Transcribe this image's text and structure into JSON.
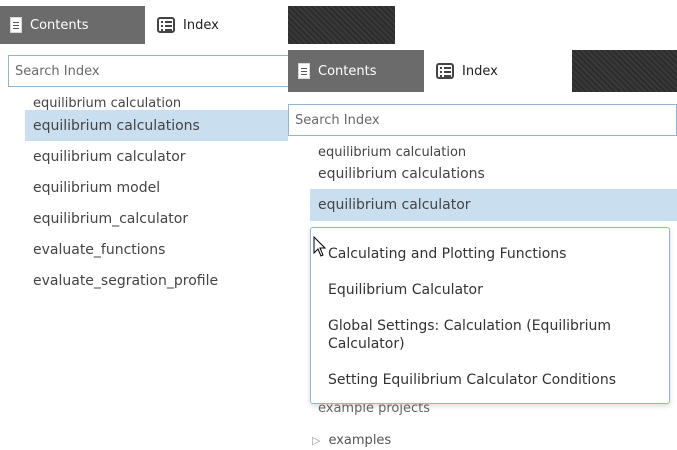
{
  "back": {
    "tabs": [
      {
        "label": "Contents",
        "icon": "document-icon"
      },
      {
        "label": "Index",
        "icon": "list-icon"
      }
    ],
    "search_placeholder": "Search Index",
    "items": [
      "equilibrium calculation",
      "equilibrium calculations",
      "equilibrium calculator",
      "equilibrium model",
      "equilibrium_calculator",
      "evaluate_functions",
      "evaluate_segration_profile"
    ],
    "selected_item": "equilibrium calculations"
  },
  "front": {
    "tabs": [
      {
        "label": "Contents",
        "icon": "document-icon"
      },
      {
        "label": "Index",
        "icon": "list-icon"
      }
    ],
    "search_placeholder": "Search Index",
    "items": [
      "equilibrium calculation",
      "equilibrium calculations",
      "equilibrium calculator"
    ],
    "selected_item": "equilibrium calculator",
    "popup": [
      "Calculating and Plotting Functions",
      "Equilibrium Calculator",
      "Global Settings: Calculation (Equilibrium Calculator)",
      "Setting Equilibrium Calculator Conditions"
    ],
    "below_items": [
      "example projects",
      "examples"
    ]
  },
  "colors": {
    "selection": "#c9deee",
    "search_border": "#8fb6d8",
    "tab_dark": "#6b6b6b"
  }
}
